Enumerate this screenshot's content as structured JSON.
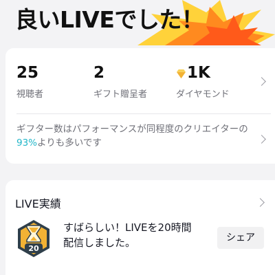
{
  "header": {
    "headline": "良いLIVEでした！"
  },
  "stats": {
    "viewers": {
      "value": "25",
      "label": "視聴者"
    },
    "gifters": {
      "value": "2",
      "label": "ギフト贈呈者"
    },
    "diamonds": {
      "value": "1K",
      "label": "ダイヤモンド"
    }
  },
  "comparison": {
    "prefix": "ギフター数はパフォーマンスが同程度のクリエイターの",
    "percent": "93%",
    "suffix": "よりも多いです"
  },
  "live_results": {
    "title": "LIVE実績",
    "badge_number": "20",
    "message": "すばらしい！LIVEを20時間配信しました。",
    "share_label": "シェア"
  },
  "colors": {
    "accent_teal": "#22b6c8",
    "burst_orange": "#ff6a1a",
    "burst_yellow": "#ffd23a",
    "badge_gold": "#f2b234",
    "badge_dark": "#2f3f4a"
  }
}
